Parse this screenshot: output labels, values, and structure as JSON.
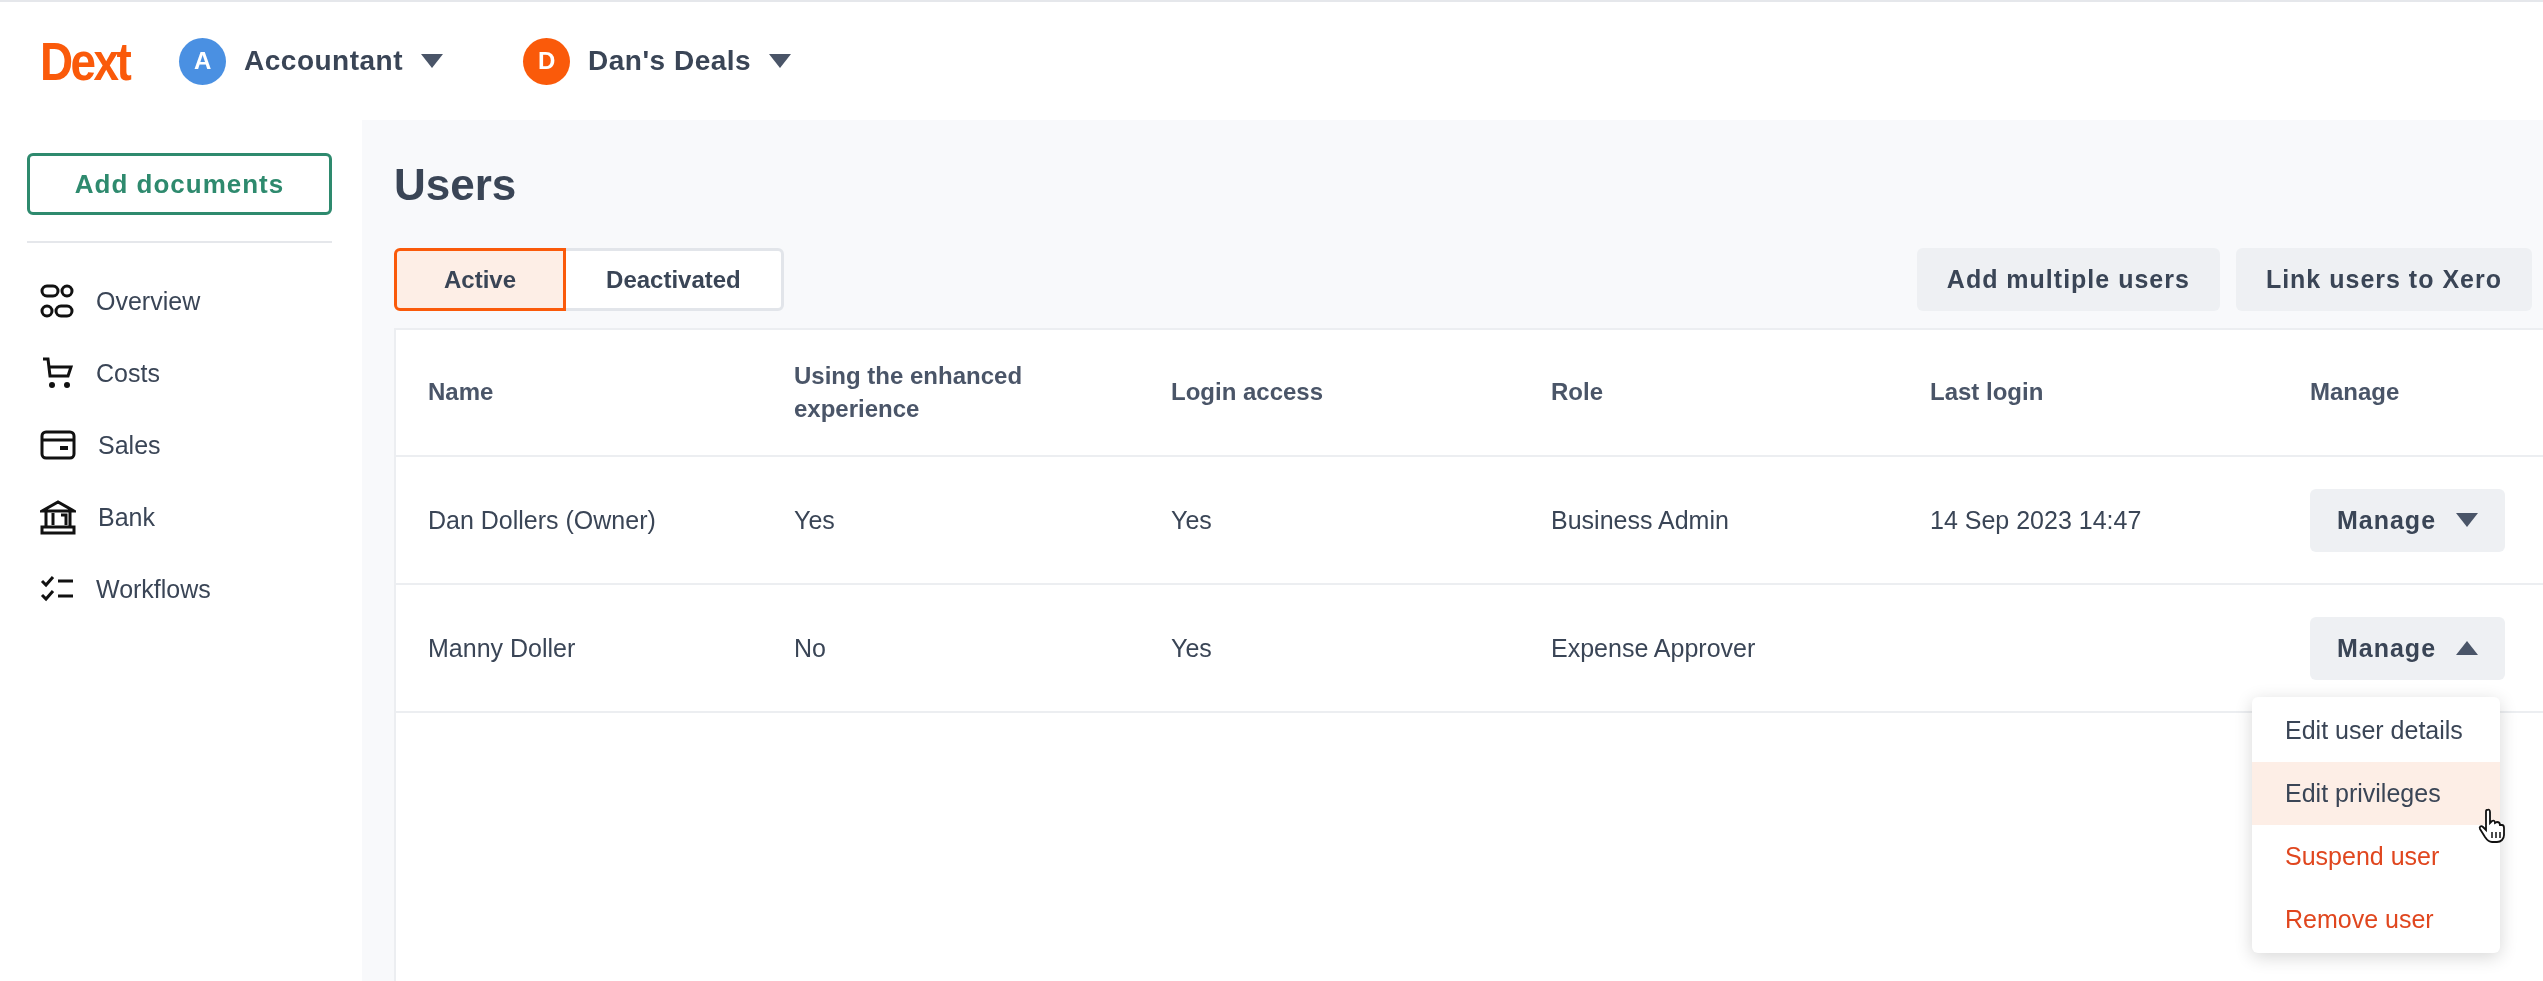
{
  "top_bar": {
    "logo": "Dext",
    "switchers": [
      {
        "initial": "A",
        "label": "Accountant",
        "color": "#4a90e2"
      },
      {
        "initial": "D",
        "label": "Dan's Deals",
        "color": "#fa5a0a"
      }
    ]
  },
  "sidebar": {
    "primary_button": "Add documents",
    "items": [
      {
        "label": "Overview"
      },
      {
        "label": "Costs"
      },
      {
        "label": "Sales"
      },
      {
        "label": "Bank"
      },
      {
        "label": "Workflows"
      }
    ]
  },
  "page": {
    "title": "Users",
    "tabs": [
      {
        "label": "Active",
        "selected": true
      },
      {
        "label": "Deactivated",
        "selected": false
      }
    ],
    "actions": [
      "Add multiple users",
      "Link users to Xero"
    ]
  },
  "table": {
    "columns": [
      "Name",
      "Using the enhanced experience",
      "Login access",
      "Role",
      "Last login",
      "Manage"
    ],
    "rows": [
      {
        "cells": [
          "Dan Dollers (Owner)",
          "Yes",
          "Yes",
          "Business Admin",
          "14 Sep 2023 14:47"
        ],
        "manage": {
          "label": "Manage",
          "expanded": false
        }
      },
      {
        "cells": [
          "Manny Doller",
          "No",
          "Yes",
          "Expense Approver"
        ],
        "manage": {
          "label": "Manage",
          "expanded": true,
          "menu": [
            {
              "label": "Edit user details",
              "kind": "normal",
              "highlighted": false
            },
            {
              "label": "Edit privileges",
              "kind": "normal",
              "highlighted": true
            },
            {
              "label": "Suspend user",
              "kind": "danger",
              "highlighted": false
            },
            {
              "label": "Remove user",
              "kind": "danger",
              "highlighted": false
            }
          ]
        }
      }
    ]
  }
}
